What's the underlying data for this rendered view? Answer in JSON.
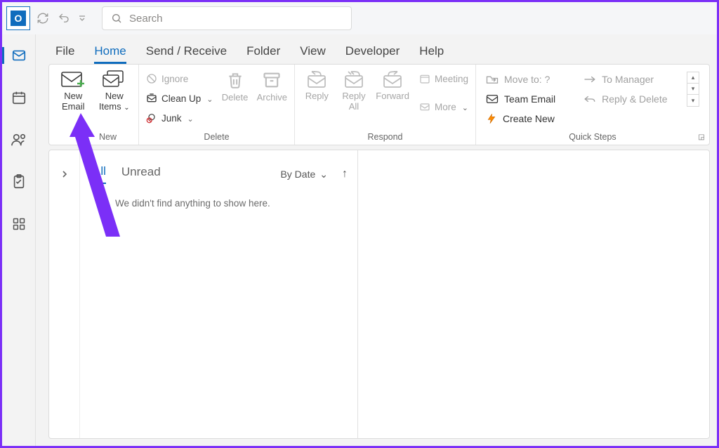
{
  "titlebar": {
    "search_placeholder": "Search"
  },
  "leftrail": {
    "items": [
      "mail",
      "calendar",
      "people",
      "tasks",
      "apps"
    ]
  },
  "menubar": {
    "items": [
      "File",
      "Home",
      "Send / Receive",
      "Folder",
      "View",
      "Developer",
      "Help"
    ],
    "active_index": 1
  },
  "ribbon": {
    "new_group": {
      "label": "New",
      "new_email": "New Email",
      "new_items": "New Items"
    },
    "delete_group": {
      "label": "Delete",
      "ignore": "Ignore",
      "cleanup": "Clean Up",
      "junk": "Junk",
      "delete": "Delete",
      "archive": "Archive"
    },
    "respond_group": {
      "label": "Respond",
      "reply": "Reply",
      "reply_all": "Reply All",
      "forward": "Forward",
      "meeting": "Meeting",
      "more": "More"
    },
    "quicksteps_group": {
      "label": "Quick Steps",
      "move_to": "Move to: ?",
      "team_email": "Team Email",
      "create_new": "Create New",
      "to_manager": "To Manager",
      "reply_delete": "Reply & Delete"
    }
  },
  "messagelist": {
    "tab_all": "All",
    "tab_unread": "Unread",
    "sort_label": "By Date",
    "empty_text": "We didn't find anything to show here."
  }
}
